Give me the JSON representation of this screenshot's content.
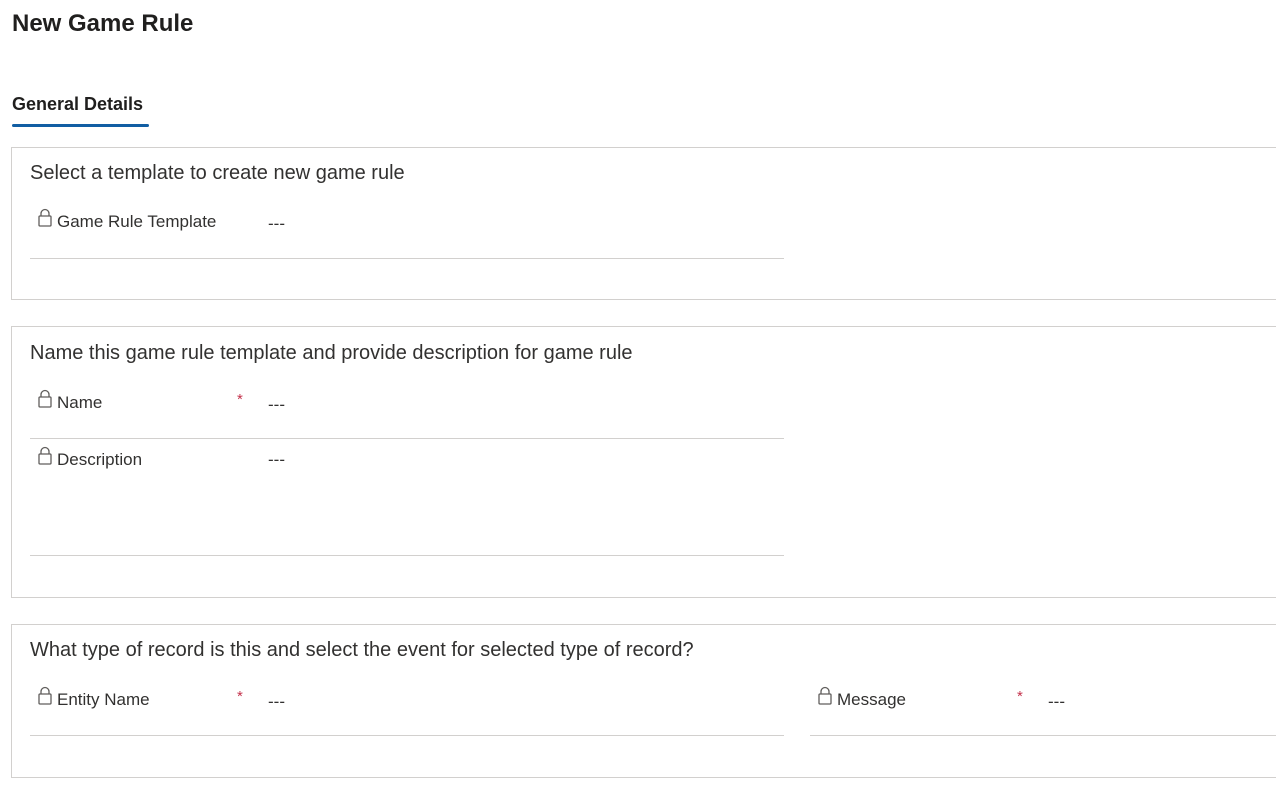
{
  "page": {
    "title": "New Game Rule"
  },
  "tabs": [
    {
      "label": "General Details",
      "active": true
    }
  ],
  "accent_color": "#115ea3",
  "required_color": "#c4314b",
  "sections": [
    {
      "title": "Select a template to create new game rule",
      "fields": [
        {
          "label": "Game Rule Template",
          "value": "---",
          "required": false,
          "locked": true
        }
      ]
    },
    {
      "title": "Name this game rule template and provide description for game rule",
      "fields": [
        {
          "label": "Name",
          "value": "---",
          "required": true,
          "locked": true
        },
        {
          "label": "Description",
          "value": "---",
          "required": false,
          "locked": true
        }
      ]
    },
    {
      "title": "What type of record is this and select the event for selected type of record?",
      "fields": [
        {
          "label": "Entity Name",
          "value": "---",
          "required": true,
          "locked": true
        },
        {
          "label": "Message",
          "value": "---",
          "required": true,
          "locked": true
        }
      ]
    }
  ],
  "required_marker": "*",
  "icons": {
    "lock": "lock-icon"
  }
}
